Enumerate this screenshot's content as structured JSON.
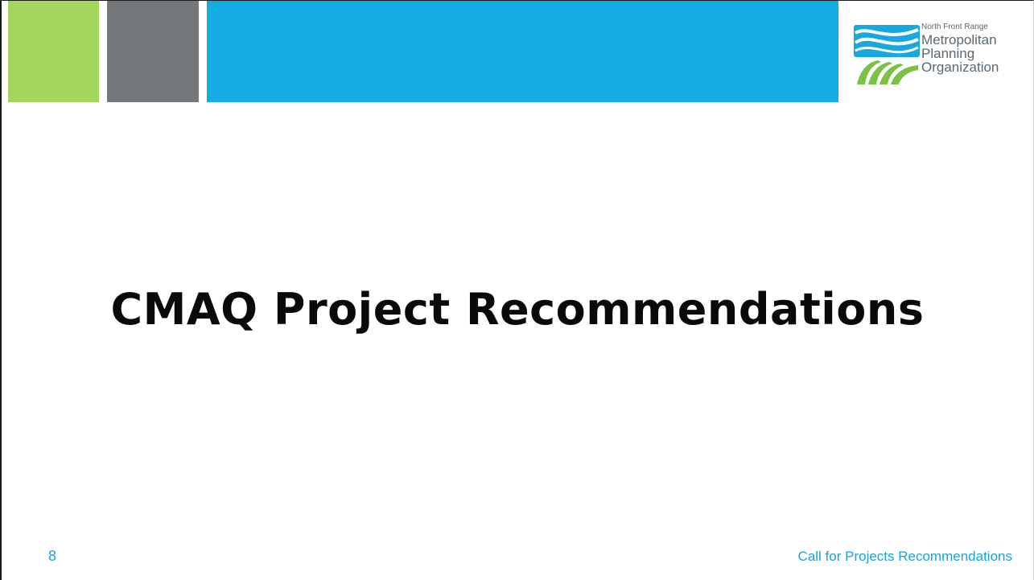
{
  "colors": {
    "green_block": "#a4d65e",
    "gray_block": "#75787a",
    "blue_banner": "#13ade4",
    "title_text": "#0a0a0a",
    "footer_text": "#1aa0dc",
    "logo_blue": "#18a8e0",
    "logo_green": "#7cc242"
  },
  "logo": {
    "line1": "North Front Range",
    "line2": "Metropolitan",
    "line3": "Planning",
    "line4": "Organization",
    "icon": "waves-and-fields-logo-icon"
  },
  "slide": {
    "title": "CMAQ Project Recommendations",
    "number": "8",
    "footer": "Call for Projects Recommendations"
  }
}
